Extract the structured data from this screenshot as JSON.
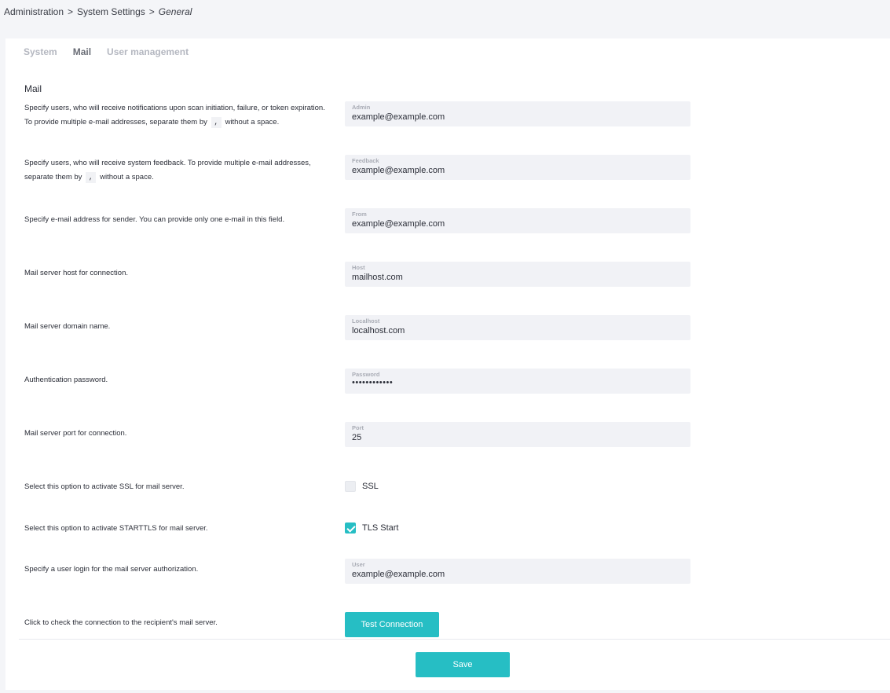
{
  "breadcrumb": {
    "items": [
      "Administration",
      "System Settings"
    ],
    "current": "General",
    "separator": ">"
  },
  "tabs": [
    {
      "label": "System",
      "active": false
    },
    {
      "label": "Mail",
      "active": true
    },
    {
      "label": "User management",
      "active": false
    }
  ],
  "section_title": "Mail",
  "rows": {
    "admin": {
      "desc_part1": "Specify users, who will receive notifications upon scan initiation, failure, or token expiration. To provide multiple e-mail addresses, separate them by",
      "desc_code": ",",
      "desc_part2": "without a space.",
      "label": "Admin",
      "value": "example@example.com"
    },
    "feedback": {
      "desc_part1": "Specify users, who will receive system feedback. To provide multiple e-mail addresses, separate them by",
      "desc_code": ",",
      "desc_part2": "without a space.",
      "label": "Feedback",
      "value": "example@example.com"
    },
    "from": {
      "desc": "Specify e-mail address for sender. You can provide only one e-mail in this field.",
      "label": "From",
      "value": "example@example.com"
    },
    "host": {
      "desc": "Mail server host for connection.",
      "label": "Host",
      "value": "mailhost.com"
    },
    "localhost": {
      "desc": "Mail server domain name.",
      "label": "Localhost",
      "value": "localhost.com"
    },
    "password": {
      "desc": "Authentication password.",
      "label": "Password",
      "value": "••••••••••••"
    },
    "port": {
      "desc": "Mail server port for connection.",
      "label": "Port",
      "value": "25"
    },
    "ssl": {
      "desc": "Select this option to activate SSL for mail server.",
      "label": "SSL",
      "checked": false
    },
    "tls": {
      "desc": "Select this option to activate STARTTLS for mail server.",
      "label": "TLS Start",
      "checked": true
    },
    "user": {
      "desc": "Specify a user login for the mail server authorization.",
      "label": "User",
      "value": "example@example.com"
    },
    "test": {
      "desc": "Click to check the connection to the recipient's mail server.",
      "button_label": "Test Connection"
    }
  },
  "save_label": "Save",
  "colors": {
    "accent": "#26bec4",
    "field_bg": "#f1f2f6",
    "page_bg": "#f4f5f8"
  }
}
